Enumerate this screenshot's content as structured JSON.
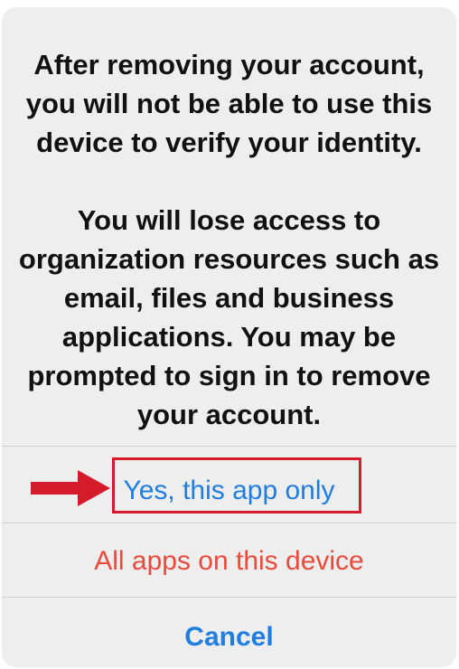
{
  "message": {
    "paragraph_1": "After removing your account, you will not be able to use this device to verify your identity.",
    "paragraph_2": "You will lose access to organization resources such as email, files and business applications. You may be prompted to sign in to remove your account."
  },
  "actions": {
    "this_app_only": "Yes, this app only",
    "all_apps": "All apps on this device",
    "cancel": "Cancel"
  },
  "colors": {
    "action_blue": "#1f7ee0",
    "destructive_red": "#e84b3c",
    "annotation_red": "#d51b2a",
    "sheet_background": "#eeeeef"
  },
  "icons": {
    "annotation_arrow": "arrow-right-icon"
  }
}
